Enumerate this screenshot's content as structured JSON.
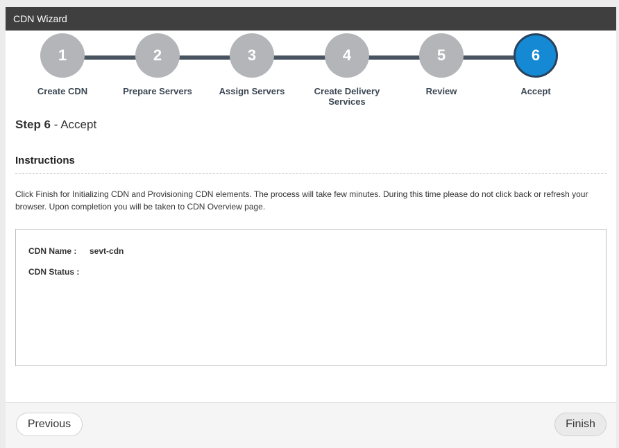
{
  "window": {
    "title": "CDN Wizard"
  },
  "steps": [
    {
      "number": "1",
      "label": "Create CDN",
      "state": "completed"
    },
    {
      "number": "2",
      "label": "Prepare Servers",
      "state": "completed"
    },
    {
      "number": "3",
      "label": "Assign Servers",
      "state": "completed"
    },
    {
      "number": "4",
      "label": "Create Delivery Services",
      "state": "completed"
    },
    {
      "number": "5",
      "label": "Review",
      "state": "completed"
    },
    {
      "number": "6",
      "label": "Accept",
      "state": "active"
    }
  ],
  "content": {
    "step_prefix": "Step 6",
    "step_separator": " - ",
    "step_name": "Accept",
    "instructions_title": "Instructions",
    "instructions_text": "Click Finish for Initializing CDN and Provisioning CDN elements. The process will take few minutes. During this time please do not click back or refresh your browser. Upon completion you will be taken to CDN Overview page."
  },
  "summary": {
    "cdn_name_label": "CDN Name :",
    "cdn_name_value": "sevt-cdn",
    "cdn_status_label": "CDN Status :",
    "cdn_status_value": ""
  },
  "footer": {
    "previous_label": "Previous",
    "finish_label": "Finish"
  },
  "colors": {
    "titlebar": "#3f3f3f",
    "step_completed": "#b3b5b8",
    "step_active": "#1589d4",
    "connector": "#495461"
  }
}
